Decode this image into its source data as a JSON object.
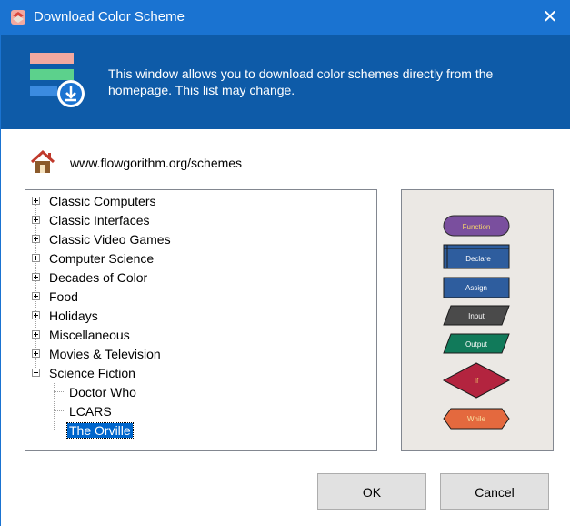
{
  "window": {
    "title": "Download Color Scheme",
    "close_glyph": "✕",
    "accent_color": "#1a73d1",
    "banner_color": "#0e5ba8"
  },
  "banner": {
    "text": "This window allows you to download color schemes directly from the homepage. This list may change.",
    "icon": "download-schemes-icon"
  },
  "url_row": {
    "icon": "home-icon",
    "url": "www.flowgorithm.org/schemes"
  },
  "tree": {
    "categories": [
      {
        "label": "Classic Computers",
        "expanded": false
      },
      {
        "label": "Classic Interfaces",
        "expanded": false
      },
      {
        "label": "Classic Video Games",
        "expanded": false
      },
      {
        "label": "Computer Science",
        "expanded": false
      },
      {
        "label": "Decades of Color",
        "expanded": false
      },
      {
        "label": "Food",
        "expanded": false
      },
      {
        "label": "Holidays",
        "expanded": false
      },
      {
        "label": "Miscellaneous",
        "expanded": false
      },
      {
        "label": "Movies & Television",
        "expanded": false
      },
      {
        "label": "Science Fiction",
        "expanded": true
      }
    ],
    "children": [
      {
        "label": "Doctor Who",
        "selected": false
      },
      {
        "label": "LCARS",
        "selected": false
      },
      {
        "label": "The Orville",
        "selected": true
      }
    ]
  },
  "preview": {
    "background": "#ebe8e4",
    "shapes": {
      "function": {
        "label": "Function",
        "fill": "#7a4f9e",
        "text": "#f2d36b"
      },
      "declare": {
        "label": "Declare",
        "fill": "#2e5d9e",
        "text": "#ffffff"
      },
      "assign": {
        "label": "Assign",
        "fill": "#2e5d9e",
        "text": "#ffffff"
      },
      "input": {
        "label": "Input",
        "fill": "#4a4a4a",
        "text": "#ffffff"
      },
      "output": {
        "label": "Output",
        "fill": "#117a5a",
        "text": "#ffffff"
      },
      "if": {
        "label": "If",
        "fill": "#b3243f",
        "text": "#f2d36b"
      },
      "while": {
        "label": "While",
        "fill": "#e4693e",
        "text": "#f8e0a0"
      }
    }
  },
  "buttons": {
    "ok": "OK",
    "cancel": "Cancel"
  }
}
